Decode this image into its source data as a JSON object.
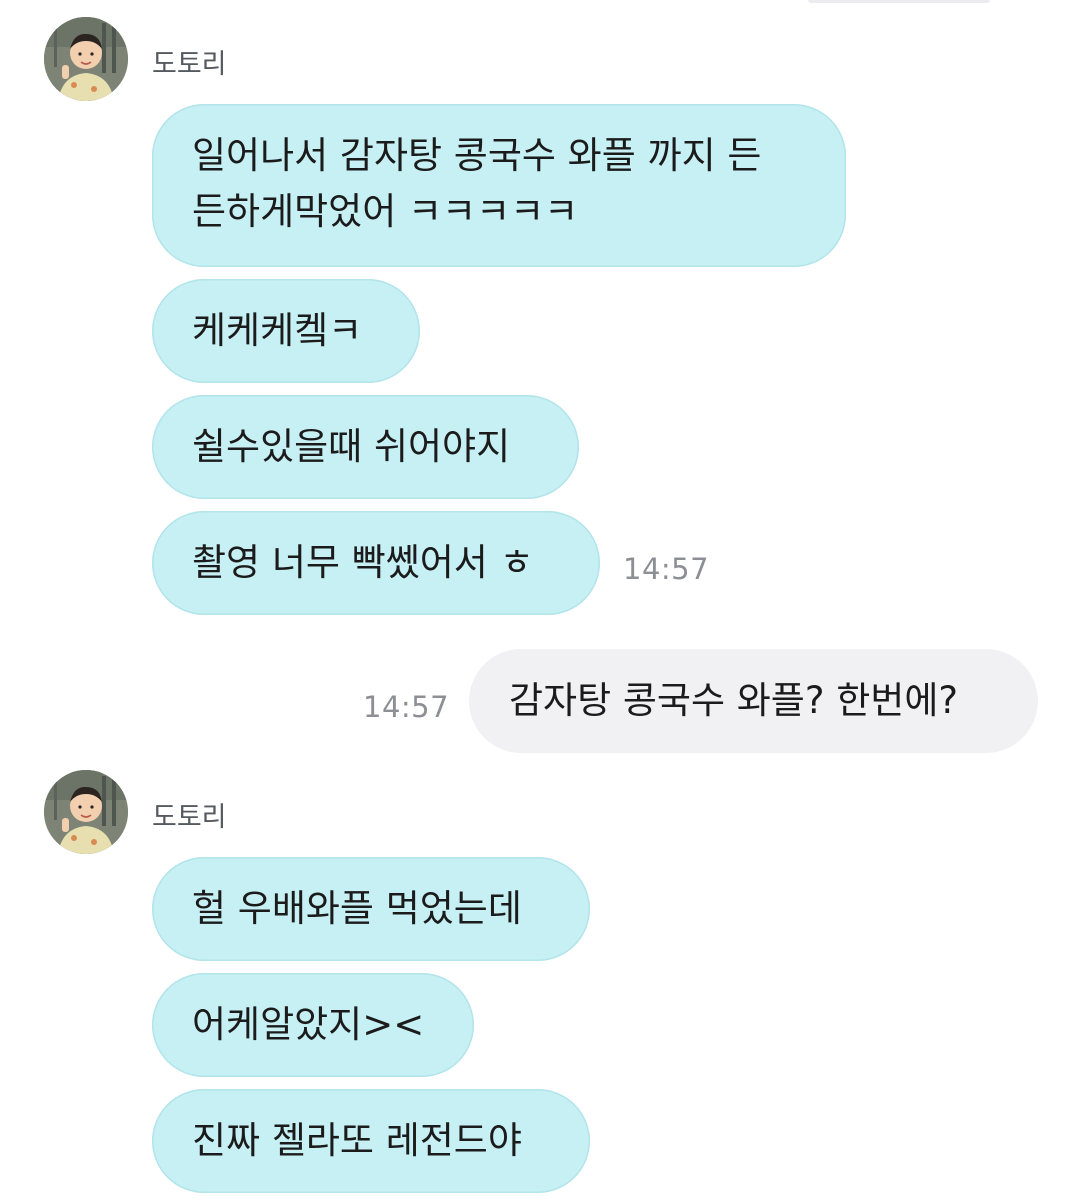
{
  "conversation": {
    "groups": [
      {
        "sender": "도토리",
        "avatar": "avatar-icon",
        "messages": [
          {
            "text": "일어나서 감자탕 콩국수 와플 까지 든\n든하게막었어 ㅋㅋㅋㅋㅋ"
          },
          {
            "text": "케케케켘ㅋ"
          },
          {
            "text": "쉴수있을때 쉬어야지"
          },
          {
            "text": "촬영 너무 빡쎘어서 ㅎ",
            "time": "14:57"
          }
        ]
      },
      {
        "sender": "me",
        "messages": [
          {
            "text": "감자탕 콩국수 와플? 한번에?",
            "time": "14:57"
          }
        ]
      },
      {
        "sender": "도토리",
        "avatar": "avatar-icon",
        "messages": [
          {
            "text": "헐 우배와플 먹었는데"
          },
          {
            "text": "어케알았지><"
          },
          {
            "text": "진짜 젤라또 레전드야"
          }
        ]
      }
    ]
  },
  "colors": {
    "incoming_bubble": "#c6f0f4",
    "outgoing_bubble": "#f1f1f4",
    "timestamp": "#8c8f94"
  }
}
